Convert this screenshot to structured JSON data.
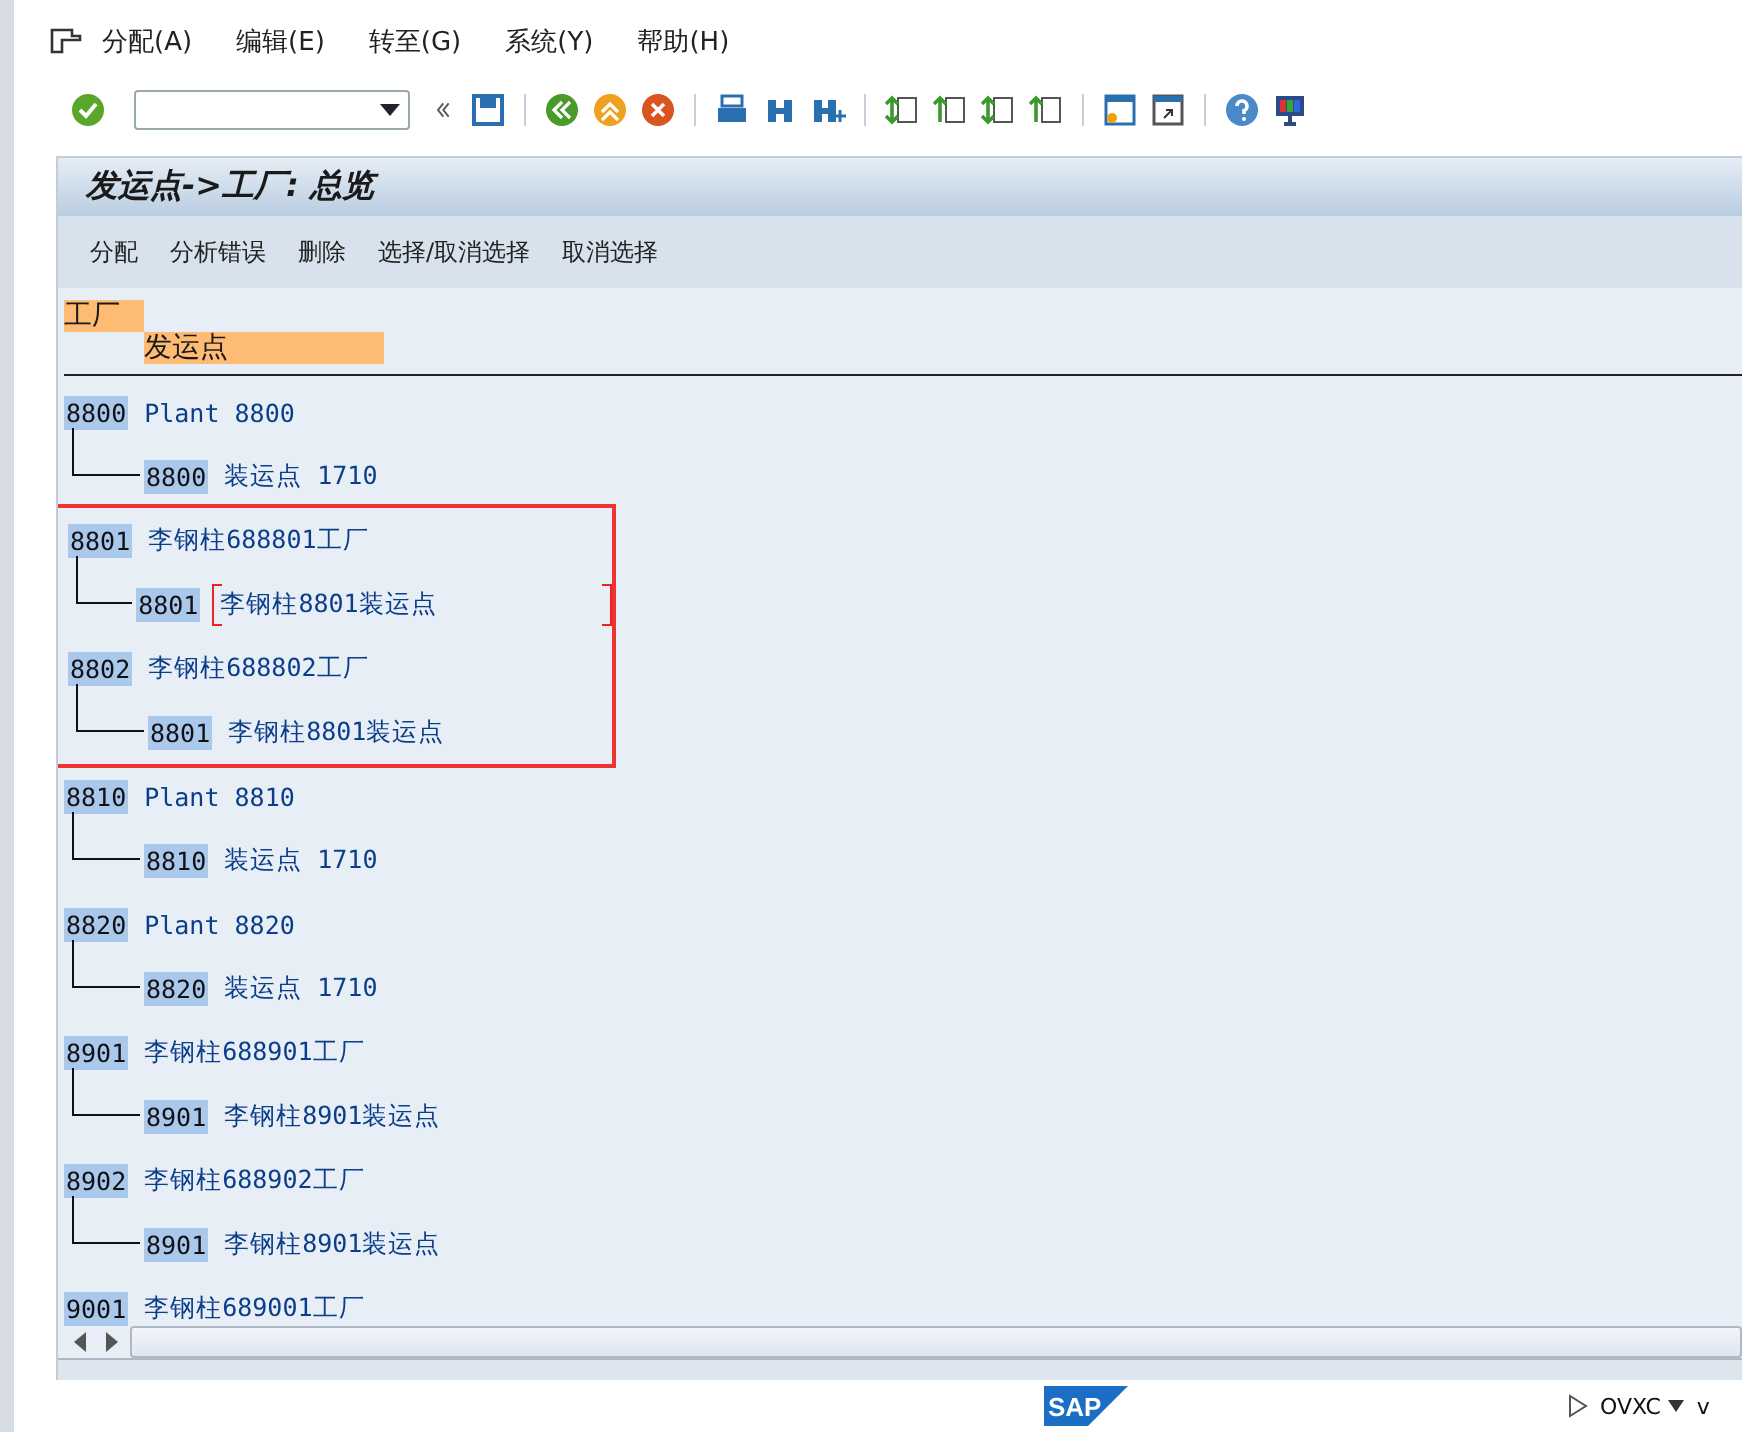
{
  "menu": [
    "分配(A)",
    "编辑(E)",
    "转至(G)",
    "系统(Y)",
    "帮助(H)"
  ],
  "title": "发运点->工厂: 总览",
  "app_toolbar": [
    "分配",
    "分析错误",
    "删除",
    "选择/取消选择",
    "取消选择"
  ],
  "headers": {
    "plant": "工厂",
    "shipping_point": "发运点"
  },
  "plants": [
    {
      "key": "8800",
      "name": "Plant 8800",
      "marked": false,
      "children": [
        {
          "key": "8800",
          "name": "装运点 1710",
          "cursor": false
        }
      ]
    },
    {
      "key": "8801",
      "name": "李钢柱688801工厂",
      "marked": true,
      "children": [
        {
          "key": "8801",
          "name": "李钢柱8801装运点",
          "cursor": true
        }
      ]
    },
    {
      "key": "8802",
      "name": "李钢柱688802工厂",
      "marked": true,
      "children": [
        {
          "key": "8801",
          "name": "李钢柱8801装运点",
          "cursor": false
        }
      ]
    },
    {
      "key": "8810",
      "name": "Plant 8810",
      "marked": false,
      "children": [
        {
          "key": "8810",
          "name": "装运点 1710",
          "cursor": false
        }
      ]
    },
    {
      "key": "8820",
      "name": "Plant 8820",
      "marked": false,
      "children": [
        {
          "key": "8820",
          "name": "装运点 1710",
          "cursor": false
        }
      ]
    },
    {
      "key": "8901",
      "name": "李钢柱688901工厂",
      "marked": false,
      "children": [
        {
          "key": "8901",
          "name": "李钢柱8901装运点",
          "cursor": false
        }
      ]
    },
    {
      "key": "8902",
      "name": "李钢柱688902工厂",
      "marked": false,
      "children": [
        {
          "key": "8901",
          "name": "李钢柱8901装运点",
          "cursor": false
        }
      ]
    },
    {
      "key": "9001",
      "name": "李钢柱689001工厂",
      "marked": false
    }
  ],
  "logo": "SAP",
  "status": {
    "system": "OVXC",
    "extra": "v"
  }
}
